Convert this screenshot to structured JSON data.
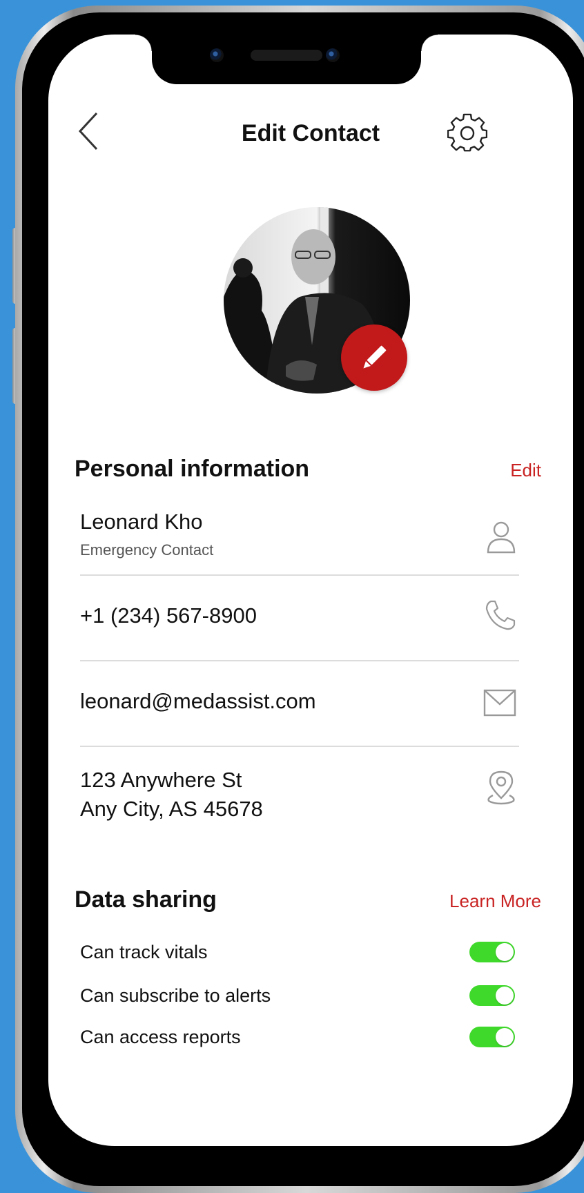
{
  "header": {
    "title": "Edit Contact"
  },
  "personal_information": {
    "title": "Personal information",
    "edit_label": "Edit",
    "name": "Leonard Kho",
    "relationship": "Emergency Contact",
    "phone": "+1 (234) 567-8900",
    "email": "leonard@medassist.com",
    "address_line1": "123 Anywhere St",
    "address_line2": "Any City, AS 45678"
  },
  "data_sharing": {
    "title": "Data sharing",
    "learn_more_label": "Learn More",
    "toggles": [
      {
        "label": "Can track vitals",
        "enabled": true
      },
      {
        "label": "Can subscribe to alerts",
        "enabled": true
      },
      {
        "label": "Can access reports",
        "enabled": true
      }
    ]
  },
  "icons": {
    "back": "chevron-left-icon",
    "settings": "gear-icon",
    "edit_photo": "pencil-icon",
    "name": "person-icon",
    "phone": "phone-icon",
    "email": "mail-icon",
    "address": "location-pin-icon"
  },
  "colors": {
    "background": "#3a93d9",
    "accent": "#c2191b",
    "toggle_on": "#3fd92b"
  }
}
